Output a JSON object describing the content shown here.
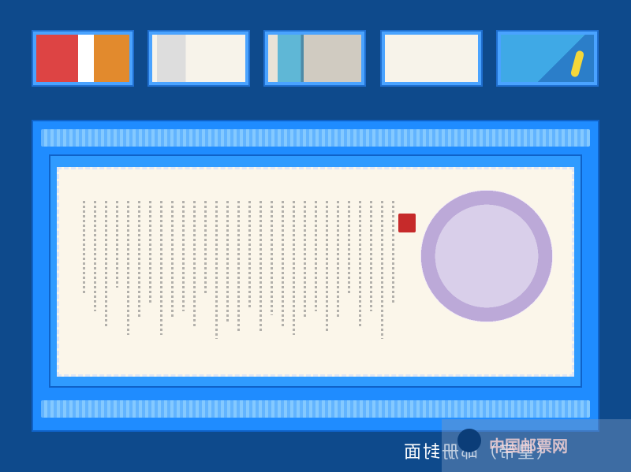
{
  "thumbnails": [
    {
      "name": "thumb-1"
    },
    {
      "name": "thumb-2"
    },
    {
      "name": "thumb-3"
    },
    {
      "name": "thumb-4"
    },
    {
      "name": "thumb-5"
    }
  ],
  "caption": "（皇帝）邮册封面",
  "watermark": {
    "text": "中国邮票网"
  },
  "colors": {
    "background": "#0e4a8c",
    "frame": "#1f8cff",
    "paper": "#fbf6ea",
    "seal": "#c62a2a"
  }
}
